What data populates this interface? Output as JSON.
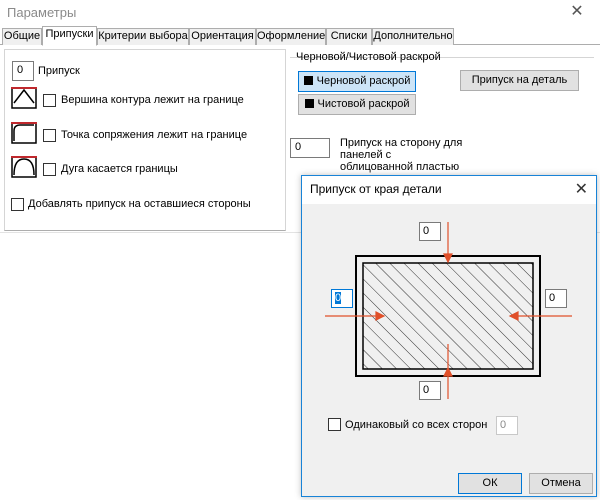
{
  "window": {
    "title": "Параметры",
    "close": "✕"
  },
  "tabs": [
    "Общие",
    "Припуски",
    "Критерии выбора",
    "Ориентация",
    "Оформление",
    "Списки",
    "Дополнительно"
  ],
  "left": {
    "allowance_value": "0",
    "allowance_label": "Припуск",
    "options": [
      "Вершина контура лежит на границе",
      "Точка сопряжения лежит на границе",
      "Дуга касается границы"
    ],
    "add_other_sides": "Добавлять припуск на оставшиеся стороны"
  },
  "right": {
    "group_title": "Черновой/Чистовой раскрой",
    "rough": "Черновой раскрой",
    "finish": "Чистовой раскрой",
    "per_part": "Припуск на деталь",
    "side_value": "0",
    "side_label": "Припуск на сторону для панелей с облицованной пластью"
  },
  "dialog": {
    "title": "Припуск от края детали",
    "close": "✕",
    "top": "0",
    "left": "0",
    "right": "0",
    "bottom": "0",
    "same_all": "Одинаковый со всех сторон",
    "same_value": "0",
    "ok": "ОК",
    "cancel": "Отмена"
  },
  "colors": {
    "arrow": "#e0502a",
    "accent": "#0078d7"
  }
}
